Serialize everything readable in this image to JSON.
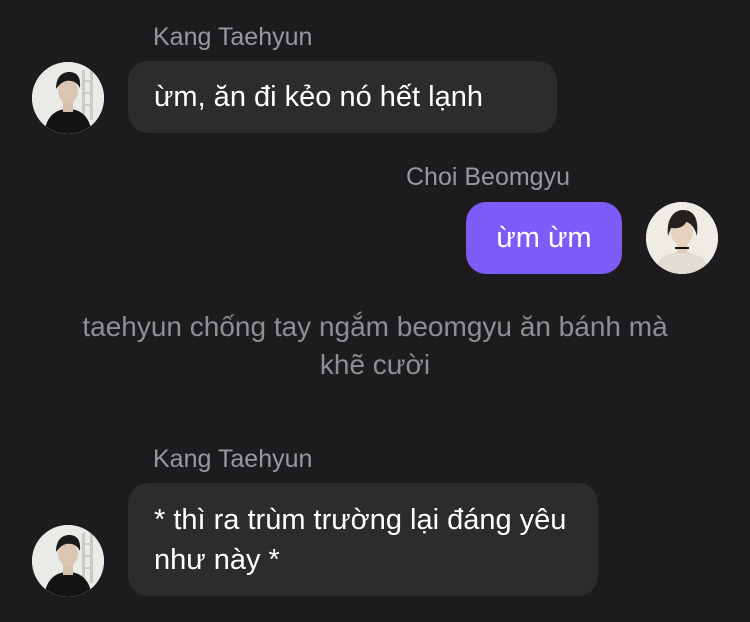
{
  "messages": [
    {
      "sender": "Kang Taehyun",
      "text": "ừm, ăn đi kẻo nó hết lạnh",
      "direction": "incoming"
    },
    {
      "sender": "Choi Beomgyu",
      "text": "ừm ừm",
      "direction": "outgoing"
    },
    {
      "narration": "taehyun chống tay ngắm beomgyu ăn bánh mà khẽ cười"
    },
    {
      "sender": "Kang Taehyun",
      "text": "* thì ra trùm trường lại đáng yêu như này *",
      "direction": "incoming"
    }
  ],
  "colors": {
    "background": "#1c1c1e",
    "incoming_bubble": "#2c2c2e",
    "outgoing_bubble": "#7b5cf6",
    "sender_name": "#98989f",
    "narration": "#8e8e93",
    "message_text": "#ffffff"
  },
  "avatars": {
    "kang_taehyun": "avatar-kang-taehyun",
    "choi_beomgyu": "avatar-choi-beomgyu"
  }
}
